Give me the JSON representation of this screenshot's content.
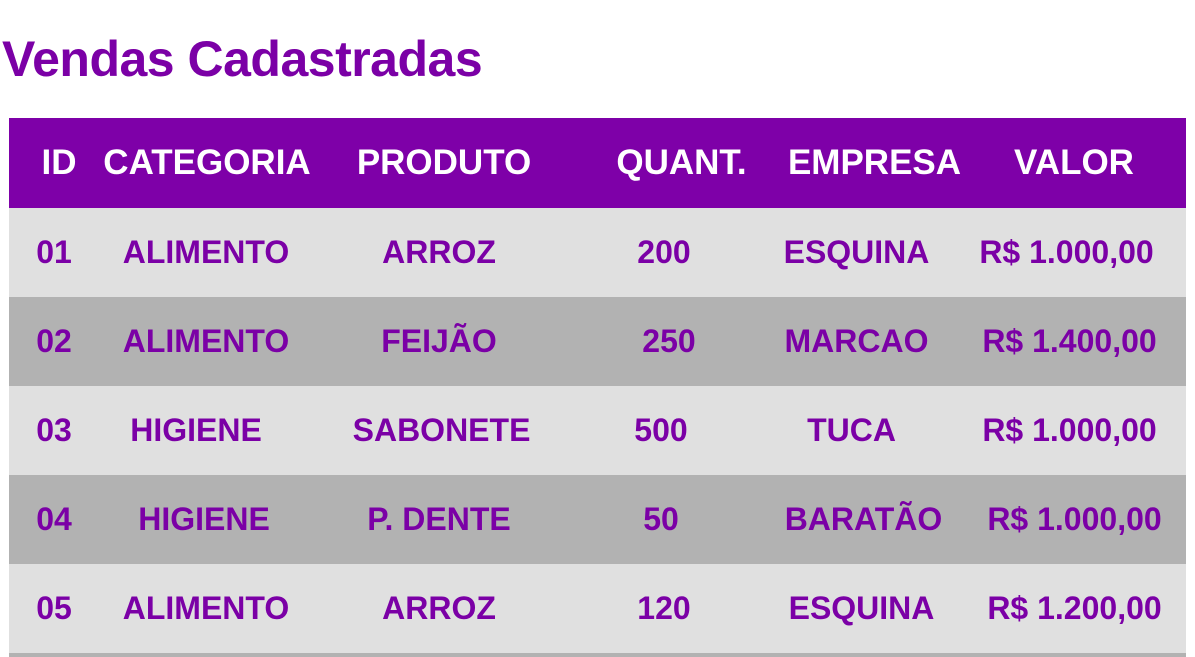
{
  "page": {
    "title": "Vendas Cadastradas"
  },
  "colors": {
    "title": "#7b00a6",
    "header_bg": "#7e00a8",
    "header_text": "#ffffff",
    "row_light": "#e0e0e0",
    "row_dark": "#b2b2b2",
    "cell_text": "#7b00a6"
  },
  "table": {
    "headers": [
      "ID",
      "CATEGORIA",
      "PRODUTO",
      "QUANT.",
      "EMPRESA",
      "VALOR"
    ],
    "rows": [
      [
        "01",
        "ALIMENTO",
        "ARROZ",
        "200",
        "ESQUINA",
        "R$ 1.000,00"
      ],
      [
        "02",
        "ALIMENTO",
        "FEIJÃO",
        "250",
        "MARCAO",
        "R$ 1.400,00"
      ],
      [
        "03",
        "HIGIENE",
        "SABONETE",
        "500",
        "TUCA",
        "R$ 1.000,00"
      ],
      [
        "04",
        "HIGIENE",
        "P. DENTE",
        "50",
        "BARATÃO",
        "R$ 1.000,00"
      ],
      [
        "05",
        "ALIMENTO",
        "ARROZ",
        "120",
        "ESQUINA",
        "R$ 1.200,00"
      ]
    ]
  }
}
